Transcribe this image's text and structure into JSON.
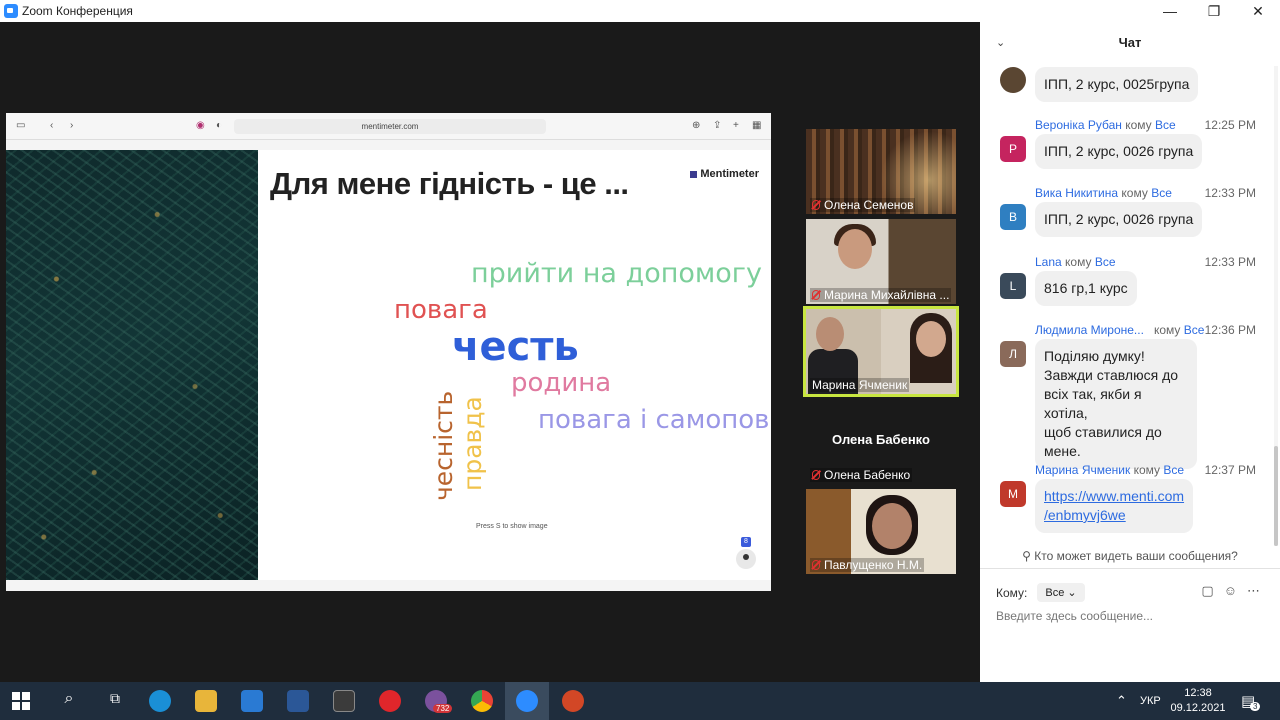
{
  "window": {
    "title": "Zoom Конференция",
    "controls": [
      "—",
      "❐",
      "✕"
    ]
  },
  "browser": {
    "url": "mentimeter.com"
  },
  "slide": {
    "title": "Для мене гідність - це ...",
    "brand": "Mentimeter",
    "hint": "Press S to show image",
    "count": "8",
    "words": [
      {
        "text": "прийти на допомогу",
        "color": "#7ccf9a"
      },
      {
        "text": "повага",
        "color": "#e05252"
      },
      {
        "text": "честь",
        "color": "#2f5fd8"
      },
      {
        "text": "родина",
        "color": "#e07aa0"
      },
      {
        "text": "повага і самопов",
        "color": "#9a97e6"
      },
      {
        "text": "чесність",
        "color": "#b8642e"
      },
      {
        "text": "правда",
        "color": "#f0c24a"
      }
    ]
  },
  "participants": [
    {
      "name": "Олена Семенов"
    },
    {
      "name": "Марина Михайлівна ..."
    },
    {
      "name": "Марина Ячменик"
    },
    {
      "name": "Олена Бабенко",
      "display": "Олена Бабенко"
    },
    {
      "name": "Павлущенко Н.М."
    }
  ],
  "chat": {
    "title": "Чат",
    "messages": [
      {
        "sender": "",
        "to_word": "",
        "to": "",
        "time": "",
        "avatar": "",
        "avatar_color": "#5a4632",
        "text": "ІПП, 2 курс, 0025група"
      },
      {
        "sender": "Вероніка Рубан",
        "to_word": "кому",
        "to": "Все",
        "time": "12:25 PM",
        "avatar": "Р",
        "avatar_color": "#c5245f",
        "text": "ІПП, 2 курс, 0026 група"
      },
      {
        "sender": "Вика Никитина",
        "to_word": "кому",
        "to": "Все",
        "time": "12:33 PM",
        "avatar": "В",
        "avatar_color": "#2f7fc1",
        "text": "ІПП, 2 курс, 0026 група"
      },
      {
        "sender": "Lana",
        "to_word": "кому",
        "to": "Все",
        "time": "12:33 PM",
        "avatar": "L",
        "avatar_color": "#3a4a5a",
        "text": "816 гр,1 курс"
      },
      {
        "sender": "Людмила Мироне...",
        "to_word": "кому",
        "to": "Все",
        "time": "12:36 PM",
        "avatar": "Л",
        "avatar_color": "#8a6a5a",
        "text": "Поділяю думку! Завжди ставлюся до всіх так, якби я хотіла, щоб ставилися до мене.",
        "lines": [
          "Поділяю думку!",
          "Завжди ставлюся до",
          "всіх так, якби я хотіла,",
          "щоб ставилися до",
          "мене."
        ]
      },
      {
        "sender": "Марина Ячменик",
        "to_word": "кому",
        "to": "Все",
        "time": "12:37 PM",
        "avatar": "М",
        "avatar_color": "#c0392b",
        "link_lines": [
          "https://www.menti.com",
          "/enbmyvj6we"
        ]
      }
    ],
    "who_can_see": "Кто может видеть ваши сообщения?",
    "to_label": "Кому:",
    "to_value": "Все",
    "input_placeholder": "Введите здесь сообщение..."
  },
  "taskbar": {
    "lang": "УКР",
    "time": "12:38",
    "date": "09.12.2021",
    "viber_badge": "732",
    "notif_badge": "3"
  }
}
